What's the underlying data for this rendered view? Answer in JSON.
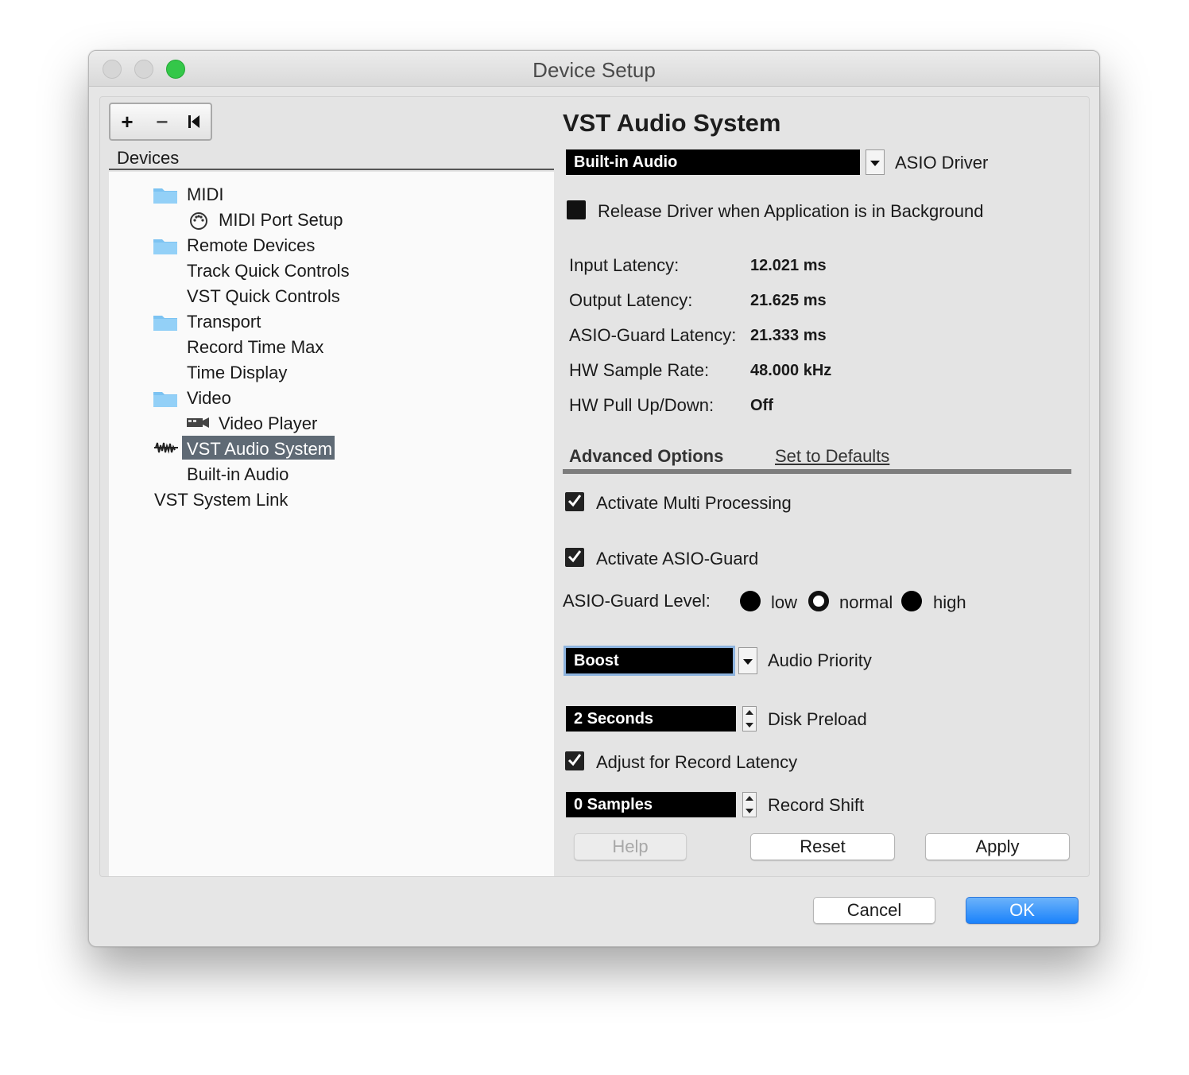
{
  "window": {
    "title": "Device Setup"
  },
  "toolbar": {
    "add": "+",
    "remove": "−",
    "reset": "⏮"
  },
  "devices": {
    "header": "Devices",
    "items": [
      {
        "label": "MIDI",
        "icon": "folder-icon"
      },
      {
        "label": "MIDI Port Setup",
        "icon": "midi-port-icon"
      },
      {
        "label": "Remote Devices",
        "icon": "folder-icon"
      },
      {
        "label": "Track Quick Controls",
        "icon": ""
      },
      {
        "label": "VST Quick Controls",
        "icon": ""
      },
      {
        "label": "Transport",
        "icon": "folder-icon"
      },
      {
        "label": "Record Time Max",
        "icon": ""
      },
      {
        "label": "Time Display",
        "icon": ""
      },
      {
        "label": "Video",
        "icon": "folder-icon"
      },
      {
        "label": "Video Player",
        "icon": "video-player-icon"
      },
      {
        "label": "VST Audio System",
        "icon": "audio-waveform-icon",
        "selected": true
      },
      {
        "label": "Built-in Audio",
        "icon": ""
      },
      {
        "label": "VST System Link",
        "icon": ""
      }
    ]
  },
  "panel": {
    "title": "VST Audio System",
    "driver": {
      "value": "Built-in Audio",
      "label": "ASIO Driver"
    },
    "release_driver": {
      "label": "Release Driver when Application is in Background",
      "checked": false
    },
    "info": [
      {
        "label": "Input Latency:",
        "value": "12.021 ms"
      },
      {
        "label": "Output Latency:",
        "value": "21.625 ms"
      },
      {
        "label": "ASIO-Guard Latency:",
        "value": "21.333 ms"
      },
      {
        "label": "HW Sample Rate:",
        "value": "48.000 kHz"
      },
      {
        "label": "HW Pull Up/Down:",
        "value": "Off"
      }
    ],
    "tabs": {
      "advanced": "Advanced Options",
      "defaults": "Set to Defaults"
    },
    "multi_processing": {
      "label": "Activate Multi Processing",
      "checked": true
    },
    "asio_guard": {
      "label": "Activate ASIO-Guard",
      "checked": true
    },
    "asio_guard_level": {
      "label": "ASIO-Guard Level:",
      "options": [
        "low",
        "normal",
        "high"
      ],
      "selected": "normal"
    },
    "audio_priority": {
      "value": "Boost",
      "label": "Audio Priority"
    },
    "disk_preload": {
      "value": "2 Seconds",
      "label": "Disk Preload"
    },
    "record_latency": {
      "label": "Adjust for Record Latency",
      "checked": true
    },
    "record_shift": {
      "value": "0 Samples",
      "label": "Record Shift"
    },
    "buttons": {
      "help": "Help",
      "reset": "Reset",
      "apply": "Apply"
    }
  },
  "footer": {
    "cancel": "Cancel",
    "ok": "OK"
  },
  "colors": {
    "selection": "#5f6a75",
    "ok_blue": "#1a82fb",
    "folder": "#7cc3f2"
  }
}
